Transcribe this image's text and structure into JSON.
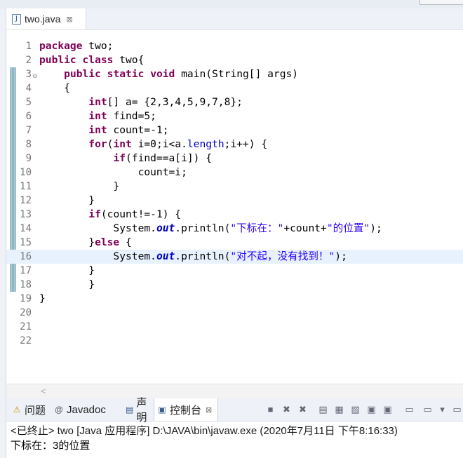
{
  "editor": {
    "tab": {
      "title": "two.java",
      "close_glyph": "⊠"
    },
    "lines": [
      {
        "n": "1",
        "segs": [
          {
            "c": "kw",
            "t": "package"
          },
          {
            "c": "",
            "t": " two;"
          }
        ]
      },
      {
        "n": "2",
        "segs": [
          {
            "c": "kw",
            "t": "public"
          },
          {
            "c": "",
            "t": " "
          },
          {
            "c": "kw",
            "t": "class"
          },
          {
            "c": "",
            "t": " two{"
          }
        ]
      },
      {
        "n": "3",
        "fold": "⊖",
        "segs": [
          {
            "c": "",
            "t": "    "
          },
          {
            "c": "kw",
            "t": "public"
          },
          {
            "c": "",
            "t": " "
          },
          {
            "c": "kw",
            "t": "static"
          },
          {
            "c": "",
            "t": " "
          },
          {
            "c": "kw",
            "t": "void"
          },
          {
            "c": "",
            "t": " main(String[] args)"
          }
        ]
      },
      {
        "n": "4",
        "segs": [
          {
            "c": "",
            "t": "    {"
          }
        ]
      },
      {
        "n": "5",
        "segs": [
          {
            "c": "",
            "t": "        "
          },
          {
            "c": "kw",
            "t": "int"
          },
          {
            "c": "",
            "t": "[] a= {2,3,4,5,9,7,8};"
          }
        ]
      },
      {
        "n": "6",
        "segs": [
          {
            "c": "",
            "t": "        "
          },
          {
            "c": "kw",
            "t": "int"
          },
          {
            "c": "",
            "t": " find=5;"
          }
        ]
      },
      {
        "n": "7",
        "segs": [
          {
            "c": "",
            "t": "        "
          },
          {
            "c": "kw",
            "t": "int"
          },
          {
            "c": "",
            "t": " count=-1;"
          }
        ]
      },
      {
        "n": "8",
        "segs": [
          {
            "c": "",
            "t": "        "
          },
          {
            "c": "kw",
            "t": "for"
          },
          {
            "c": "",
            "t": "("
          },
          {
            "c": "kw",
            "t": "int"
          },
          {
            "c": "",
            "t": " i=0;i<a."
          },
          {
            "c": "fld",
            "t": "length"
          },
          {
            "c": "",
            "t": ";i++) {"
          }
        ]
      },
      {
        "n": "9",
        "segs": [
          {
            "c": "",
            "t": "            "
          },
          {
            "c": "kw",
            "t": "if"
          },
          {
            "c": "",
            "t": "(find==a[i]) {"
          }
        ]
      },
      {
        "n": "10",
        "segs": [
          {
            "c": "",
            "t": "                count=i;"
          }
        ]
      },
      {
        "n": "11",
        "segs": [
          {
            "c": "",
            "t": "            }"
          }
        ]
      },
      {
        "n": "12",
        "segs": [
          {
            "c": "",
            "t": "        }"
          }
        ]
      },
      {
        "n": "13",
        "segs": [
          {
            "c": "",
            "t": "        "
          },
          {
            "c": "kw",
            "t": "if"
          },
          {
            "c": "",
            "t": "(count!=-1) {"
          }
        ]
      },
      {
        "n": "14",
        "segs": [
          {
            "c": "",
            "t": "            System."
          },
          {
            "c": "smeth",
            "t": "out"
          },
          {
            "c": "",
            "t": ".println("
          },
          {
            "c": "st",
            "t": "\"下标在：\""
          },
          {
            "c": "",
            "t": "+count+"
          },
          {
            "c": "st",
            "t": "\"的位置\""
          },
          {
            "c": "",
            "t": ");"
          }
        ]
      },
      {
        "n": "15",
        "segs": [
          {
            "c": "",
            "t": "        }"
          },
          {
            "c": "kw",
            "t": "else"
          },
          {
            "c": "",
            "t": " {"
          }
        ]
      },
      {
        "n": "16",
        "current": true,
        "segs": [
          {
            "c": "",
            "t": "            System."
          },
          {
            "c": "smeth",
            "t": "out"
          },
          {
            "c": "",
            "t": ".println("
          },
          {
            "c": "st",
            "t": "\"对不起，没有找到！\""
          },
          {
            "c": "",
            "t": ");"
          }
        ]
      },
      {
        "n": "17",
        "segs": [
          {
            "c": "",
            "t": "        }"
          }
        ]
      },
      {
        "n": "18",
        "segs": [
          {
            "c": "",
            "t": "        }"
          }
        ]
      },
      {
        "n": "19",
        "segs": [
          {
            "c": "",
            "t": "}"
          }
        ]
      },
      {
        "n": "20",
        "segs": []
      },
      {
        "n": "21",
        "segs": []
      },
      {
        "n": "22",
        "segs": []
      }
    ]
  },
  "views": {
    "tabs": [
      {
        "label": "问题",
        "icon": "problems-icon",
        "glyph": "⚠"
      },
      {
        "label": "Javadoc",
        "icon": "javadoc-icon",
        "glyph": "@"
      },
      {
        "label": "声明",
        "icon": "declaration-icon",
        "glyph": "▤"
      },
      {
        "label": "控制台",
        "icon": "console-icon",
        "glyph": "▣",
        "active": true,
        "close_glyph": "⊠"
      }
    ],
    "toolbar": [
      {
        "name": "terminate-icon",
        "glyph": "■"
      },
      {
        "name": "remove-launch-icon",
        "glyph": "✖"
      },
      {
        "name": "remove-all-icon",
        "glyph": "✖"
      },
      {
        "name": "clear-console-icon",
        "glyph": "▤"
      },
      {
        "name": "scroll-lock-icon",
        "glyph": "▦"
      },
      {
        "name": "word-wrap-icon",
        "glyph": "▧"
      },
      {
        "name": "show-on-output-icon",
        "glyph": "▣"
      },
      {
        "name": "show-on-error-icon",
        "glyph": "▣"
      },
      {
        "name": "pin-console-icon",
        "glyph": "▭"
      },
      {
        "name": "display-console-icon",
        "glyph": "▭"
      },
      {
        "name": "view-menu-icon",
        "glyph": "▾"
      },
      {
        "name": "minimize-icon",
        "glyph": "▭"
      }
    ]
  },
  "console": {
    "header": "<已终止> two [Java 应用程序] D:\\JAVA\\bin\\javaw.exe  (2020年7月11日 下午8:16:33)",
    "output": "下标在：3的位置"
  }
}
